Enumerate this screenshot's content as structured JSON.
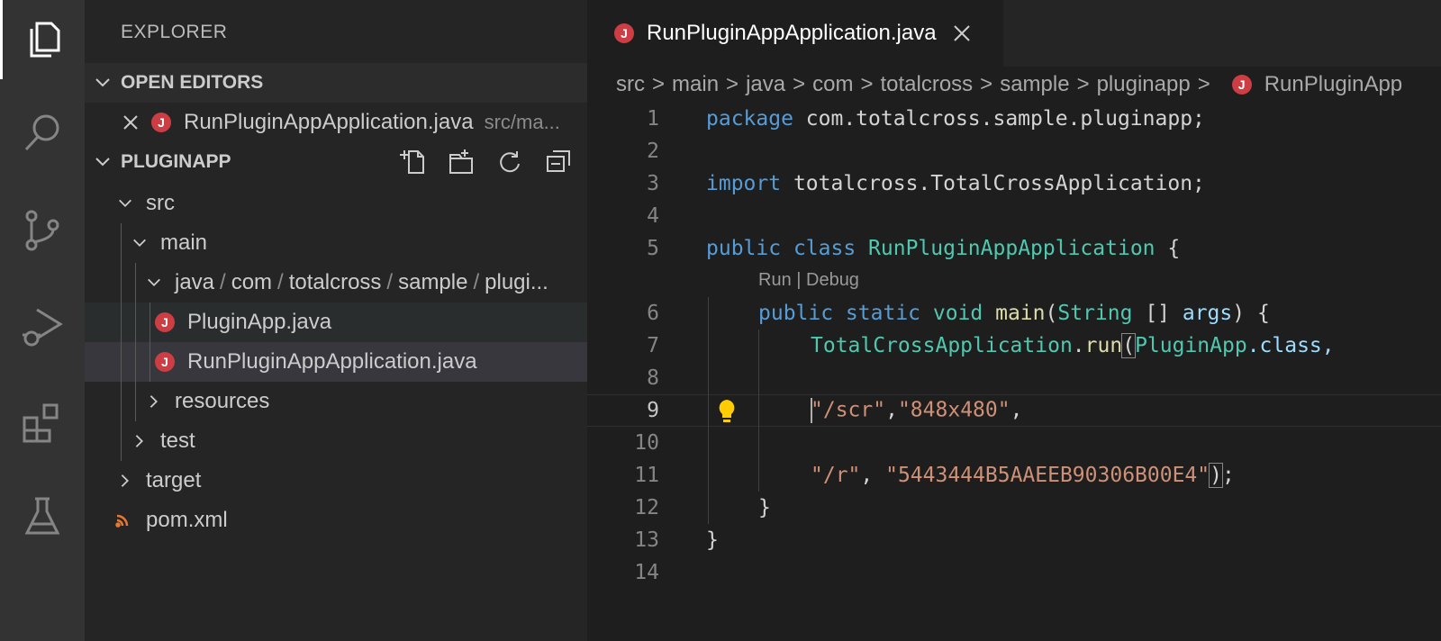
{
  "activity_bar": {
    "items": [
      {
        "name": "explorer",
        "icon": "files-icon",
        "active": true
      },
      {
        "name": "search",
        "icon": "search-icon"
      },
      {
        "name": "source-control",
        "icon": "source-control-icon"
      },
      {
        "name": "run-debug",
        "icon": "run-debug-icon"
      },
      {
        "name": "extensions",
        "icon": "extensions-icon"
      },
      {
        "name": "testing",
        "icon": "flask-icon"
      }
    ]
  },
  "sidebar": {
    "title": "EXPLORER",
    "open_editors": {
      "label": "OPEN EDITORS",
      "files": [
        {
          "name": "RunPluginAppApplication.java",
          "path": "src/ma..."
        }
      ]
    },
    "project": {
      "label": "PLUGINAPP",
      "actions": [
        "new-file-icon",
        "new-folder-icon",
        "refresh-icon",
        "collapse-all-icon"
      ],
      "tree": {
        "src": "src",
        "main": "main",
        "java_path": [
          "java",
          "com",
          "totalcross",
          "sample",
          "plugi..."
        ],
        "path_sep": "/",
        "file1": "PluginApp.java",
        "file2": "RunPluginAppApplication.java",
        "resources": "resources",
        "test": "test",
        "target": "target",
        "pom": "pom.xml"
      }
    }
  },
  "editor": {
    "tab": {
      "title": "RunPluginAppApplication.java",
      "badge": "J"
    },
    "breadcrumbs": [
      "src",
      "main",
      "java",
      "com",
      "totalcross",
      "sample",
      "pluginapp",
      "RunPluginApp"
    ],
    "breadcrumb_sep": ">",
    "codelens": "Run | Debug",
    "line_numbers": [
      "1",
      "2",
      "3",
      "4",
      "5",
      "6",
      "7",
      "8",
      "9",
      "10",
      "11",
      "12",
      "13",
      "14"
    ],
    "code": {
      "l1_kw": "package",
      "l1_rest": " com.totalcross.sample.pluginapp;",
      "l3_kw": "import",
      "l3_rest": " totalcross.TotalCrossApplication;",
      "l5_kw1": "public",
      "l5_kw2": " class",
      "l5_cls": " RunPluginAppApplication",
      "l5_rest": " {",
      "l6_kw": "public static",
      "l6_void": " void",
      "l6_fn": " main",
      "l6_p1": "(",
      "l6_type": "String",
      "l6_p2": " [] ",
      "l6_var": "args",
      "l6_p3": ") {",
      "l7_cls": "TotalCrossApplication",
      "l7_dot": ".",
      "l7_fn": "run",
      "l7_paren": "(",
      "l7_cls2": "PluginApp",
      "l7_rest": ".class,",
      "l9_s1": "\"/scr\"",
      "l9_c1": ",",
      "l9_s2": "\"848x480\"",
      "l9_c2": ",",
      "l11_s1": "\"/r\"",
      "l11_c1": ", ",
      "l11_s2": "\"5443444B5AAEEB90306B00E4\"",
      "l11_paren": ")",
      "l11_end": ";",
      "l12": "}",
      "l13": "}"
    }
  },
  "colors": {
    "keyword": "#569cd6",
    "class": "#4ec9b0",
    "function": "#dcdcaa",
    "string": "#ce9178",
    "java_badge": "#cc3e44"
  }
}
